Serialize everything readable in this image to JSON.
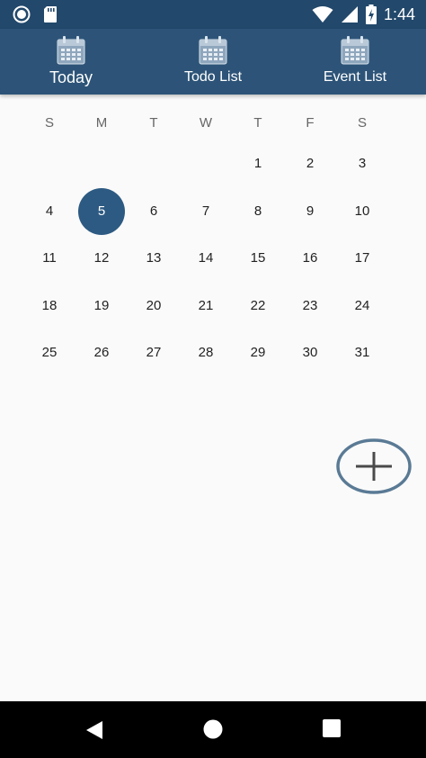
{
  "status_bar": {
    "time": "1:44",
    "icons": [
      "notification-dot-icon",
      "sd-card-icon",
      "wifi-icon",
      "signal-icon",
      "battery-charging-icon"
    ]
  },
  "tabs": [
    {
      "label": "Today",
      "icon": "calendar-icon",
      "active": true
    },
    {
      "label": "Todo List",
      "icon": "calendar-icon",
      "active": false
    },
    {
      "label": "Event List",
      "icon": "calendar-icon",
      "active": false
    }
  ],
  "calendar": {
    "weekdays": [
      "S",
      "M",
      "T",
      "W",
      "T",
      "F",
      "S"
    ],
    "weeks": [
      [
        "",
        "",
        "",
        "",
        "1",
        "2",
        "3"
      ],
      [
        "4",
        "5",
        "6",
        "7",
        "8",
        "9",
        "10"
      ],
      [
        "11",
        "12",
        "13",
        "14",
        "15",
        "16",
        "17"
      ],
      [
        "18",
        "19",
        "20",
        "21",
        "22",
        "23",
        "24"
      ],
      [
        "25",
        "26",
        "27",
        "28",
        "29",
        "30",
        "31"
      ]
    ],
    "selected_day": "5",
    "selected_color": "#2d5a82"
  },
  "fab": {
    "icon": "add-circle-icon"
  },
  "nav": {
    "icons": [
      "back-icon",
      "home-icon",
      "recents-icon"
    ]
  },
  "colors": {
    "status_bar": "#22486b",
    "app_bar": "#2d5478",
    "background": "#fafafa"
  }
}
